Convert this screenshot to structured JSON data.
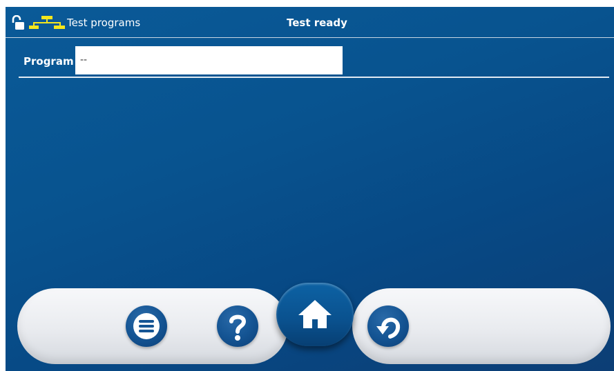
{
  "header": {
    "title": "Test programs",
    "status": "Test ready",
    "lock_icon": "unlocked-padlock-icon",
    "network_icon": "network-tree-icon",
    "network_color": "#f5e61c"
  },
  "program": {
    "label": "Program",
    "value": "--"
  },
  "nav": {
    "buttons": [
      {
        "name": "menu",
        "icon": "hamburger-menu-icon"
      },
      {
        "name": "help",
        "icon": "question-mark-icon"
      },
      {
        "name": "home",
        "icon": "home-icon",
        "active": true
      },
      {
        "name": "back",
        "icon": "undo-arrow-icon"
      }
    ]
  },
  "colors": {
    "background": "#08538f",
    "nav_bar": "#eceef1",
    "button_blue": "#155594",
    "accent_yellow": "#f5e61c"
  }
}
